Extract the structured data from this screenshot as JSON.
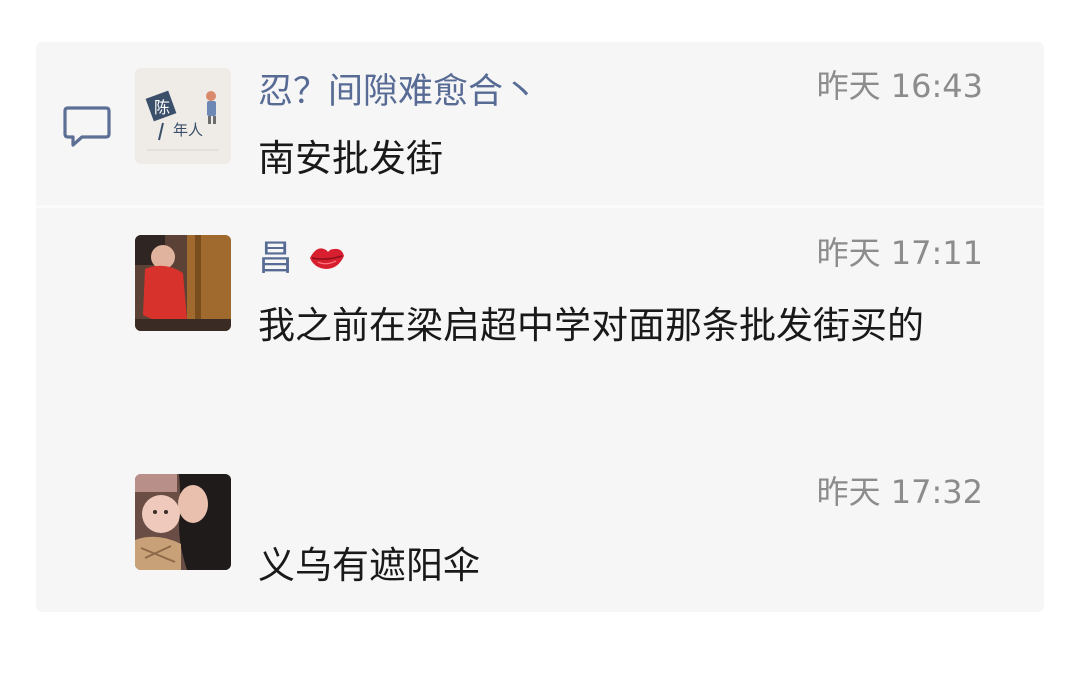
{
  "comments": [
    {
      "author": "忍？间隙难愈合丶",
      "time": "昨天 16:43",
      "text": "南安批发街",
      "avatar_text_1": "陈",
      "avatar_text_2": "年人"
    },
    {
      "author": "昌",
      "time": "昨天 17:11",
      "text": "我之前在梁启超中学对面那条批发街买的",
      "emoji": "lips-emoji"
    },
    {
      "author": "",
      "time": "昨天 17:32",
      "text": "义乌有遮阳伞"
    }
  ],
  "icons": {
    "comment": "comment-bubble-icon"
  },
  "colors": {
    "author": "#576b95",
    "time": "#8c8c8c",
    "text": "#191919",
    "panel": "#f6f6f6"
  }
}
